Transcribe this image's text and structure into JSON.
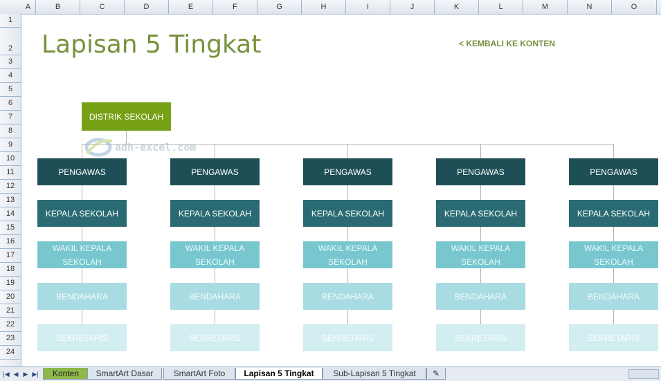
{
  "columns": [
    "A",
    "B",
    "C",
    "D",
    "E",
    "F",
    "G",
    "H",
    "I",
    "J",
    "K",
    "L",
    "M",
    "N",
    "O"
  ],
  "rows": [
    "1",
    "2",
    "3",
    "4",
    "5",
    "6",
    "7",
    "8",
    "9",
    "10",
    "11",
    "12",
    "13",
    "14",
    "15",
    "16",
    "17",
    "18",
    "19",
    "20",
    "21",
    "22",
    "23",
    "24"
  ],
  "title": "Lapisan 5 Tingkat",
  "back_link": "< KEMBALI KE KONTEN",
  "watermark": "adh-excel.com",
  "org": {
    "top": "DISTRIK SEKOLAH",
    "level1": "PENGAWAS",
    "level2": "KEPALA SEKOLAH",
    "level3": "WAKIL KEPALA SEKOLAH",
    "level4": "BENDAHARA",
    "level5": "SEKRETARIS"
  },
  "sheet_tabs": [
    {
      "label": "Konten",
      "state": "colored"
    },
    {
      "label": "SmartArt Dasar",
      "state": "inactive"
    },
    {
      "label": "SmartArt Foto",
      "state": "inactive"
    },
    {
      "label": "Lapisan 5 Tingkat",
      "state": "active"
    },
    {
      "label": "Sub-Lapisan 5 Tingkat",
      "state": "inactive"
    }
  ],
  "nav_buttons": [
    "|◀",
    "◀",
    "▶",
    "▶|"
  ],
  "colors": {
    "title": "#76923c",
    "top_box": "#76a015",
    "level1": "#1e4f57",
    "level2": "#2a6b73",
    "level3": "#78c7cf",
    "level4": "#a9dce2",
    "level5": "#d3eef1"
  }
}
